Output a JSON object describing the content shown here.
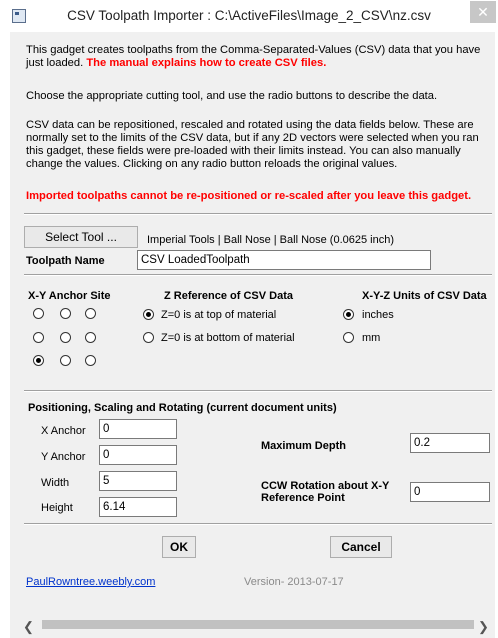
{
  "window": {
    "title": "CSV Toolpath Importer : C:\\ActiveFiles\\Image_2_CSV\\nz.csv",
    "close_glyph": "✕",
    "icon": "window-icon"
  },
  "intro": {
    "p1_text": "This gadget creates toolpaths from the Comma-Separated-Values (CSV) data that you have just loaded.",
    "p1_red": "The manual explains how to create CSV files.",
    "p2": "Choose the appropriate cutting tool, and use the radio buttons to describe the data.",
    "p3": "CSV data can be repositioned, rescaled and rotated using the data fields below.  These are normally set to the limits of the CSV data, but if any 2D vectors were selected when you ran this gadget, these fields were pre-loaded with their limits instead.  You can also manually change the values.  Clicking on any radio button reloads the original values.",
    "warning": "Imported toolpaths cannot be re-positioned or re-scaled after you leave this gadget."
  },
  "tool": {
    "select_label": "Select Tool ...",
    "tool_desc": "Imperial Tools | Ball Nose | Ball Nose (0.0625 inch)",
    "name_label": "Toolpath Name",
    "name_value": "CSV LoadedToolpath"
  },
  "anchor": {
    "heading": "X-Y Anchor Site",
    "selected_index": 6
  },
  "zref": {
    "heading": "Z Reference of CSV Data",
    "options": [
      "Z=0 is at top of material",
      "Z=0 is at bottom of material"
    ],
    "selected": 0
  },
  "units": {
    "heading": "X-Y-Z Units of CSV Data",
    "options": [
      "inches",
      "mm"
    ],
    "selected": 0
  },
  "positioning": {
    "heading": "Positioning, Scaling and Rotating (current document units)",
    "x_anchor_label": "X Anchor",
    "x_anchor": "0",
    "y_anchor_label": "Y Anchor",
    "y_anchor": "0",
    "width_label": "Width",
    "width": "5",
    "height_label": "Height",
    "height": "6.14",
    "max_depth_label": "Maximum Depth",
    "max_depth": "0.2",
    "rotation_label_1": "CCW Rotation about X-Y",
    "rotation_label_2": "Reference Point",
    "rotation": "0"
  },
  "buttons": {
    "ok": "OK",
    "cancel": "Cancel"
  },
  "footer": {
    "link": "PaulRowntree.weebly.com",
    "version": "Version- 2013-07-17"
  },
  "scrollbar": {
    "left_glyph": "❮",
    "right_glyph": "❯"
  }
}
